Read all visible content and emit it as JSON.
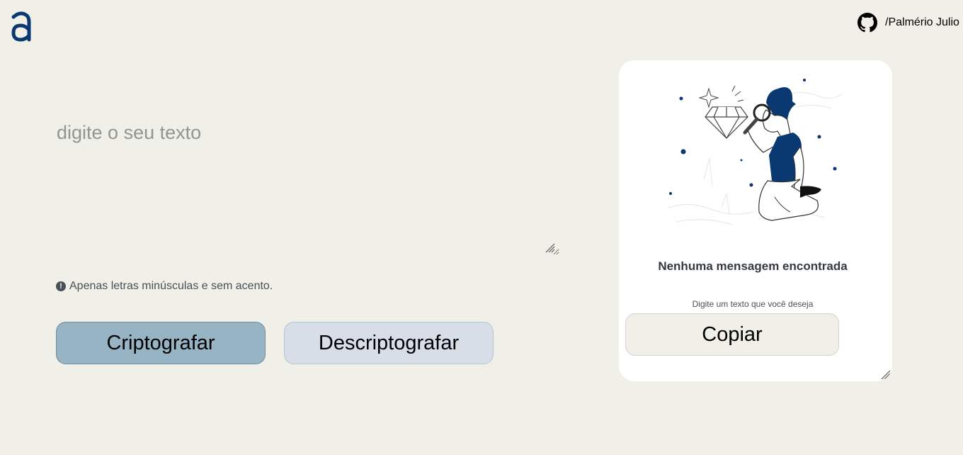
{
  "brand": {
    "logo_letter": "a",
    "accent_color": "#0a3871"
  },
  "header": {
    "github_label": "/Palmério Julio",
    "github_icon": "github-icon"
  },
  "input": {
    "placeholder": "digite o seu texto",
    "value": ""
  },
  "hint": {
    "icon": "exclamation-circle-icon",
    "text": "Apenas letras minúsculas e sem acento."
  },
  "buttons": {
    "encrypt_label": "Criptografar",
    "decrypt_label": "Descriptografar"
  },
  "output": {
    "empty_title": "Nenhuma mensagem encontrada",
    "empty_subtitle": "Digite um texto que você deseja",
    "copy_label": "Copiar",
    "illustration": "person-with-magnifying-glass-and-diamond"
  },
  "colors": {
    "background": "#f0efe8",
    "encrypt_button": "#97b4c4",
    "decrypt_button": "#d8dee8",
    "panel": "#ffffff"
  }
}
